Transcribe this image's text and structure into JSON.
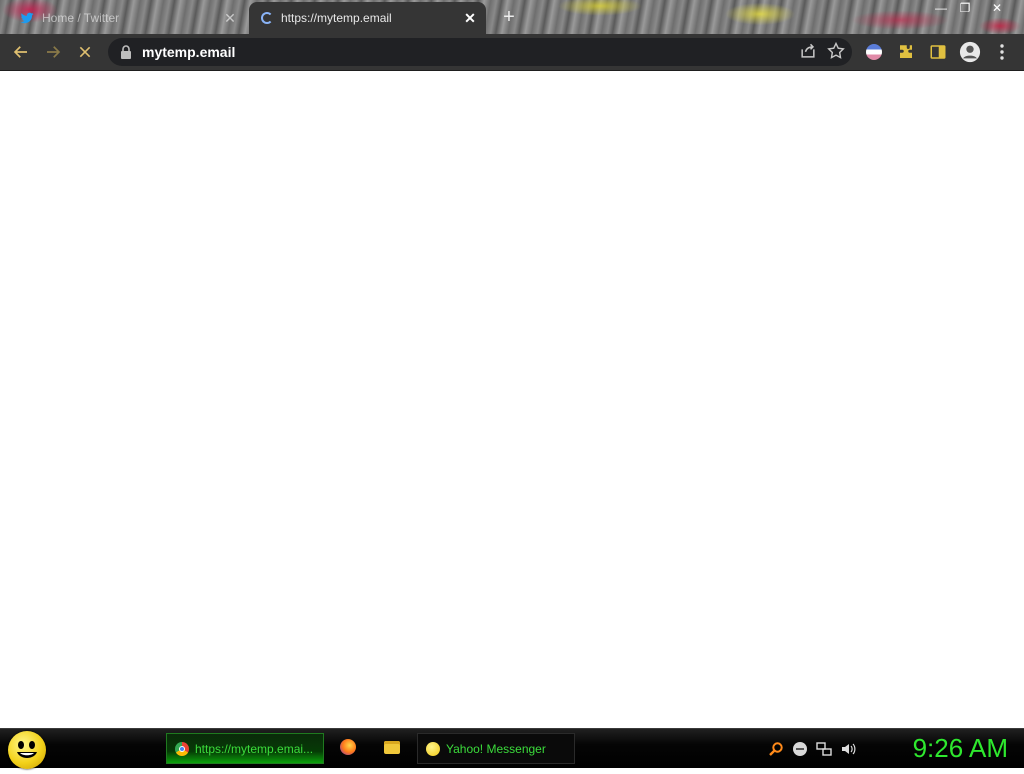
{
  "tabs": [
    {
      "title": "Home / Twitter",
      "icon": "twitter-icon",
      "active": false
    },
    {
      "title": "https://mytemp.email",
      "icon": "loading-spinner-icon",
      "active": true
    }
  ],
  "window_controls": [
    "minimize",
    "restore",
    "close"
  ],
  "toolbar": {
    "url": "mytemp.email",
    "buttons": [
      "back",
      "forward",
      "stop"
    ]
  },
  "taskbar": {
    "tasks": [
      {
        "label": "https://mytemp.emai...",
        "icon": "chrome-icon"
      },
      {
        "label": "Yahoo! Messenger",
        "icon": "yahoo-messenger-icon"
      }
    ],
    "quick_launch": [
      "firefox-icon",
      "folder-icon"
    ],
    "tray_icons": [
      "search-icon",
      "minus-circle-icon",
      "network-icon",
      "volume-icon"
    ],
    "clock": "9:26 AM"
  },
  "colors": {
    "toolbar": "#353535",
    "omnibox": "#202124",
    "taskbar_text": "#3bdc3b",
    "clock": "#2ee82e"
  }
}
